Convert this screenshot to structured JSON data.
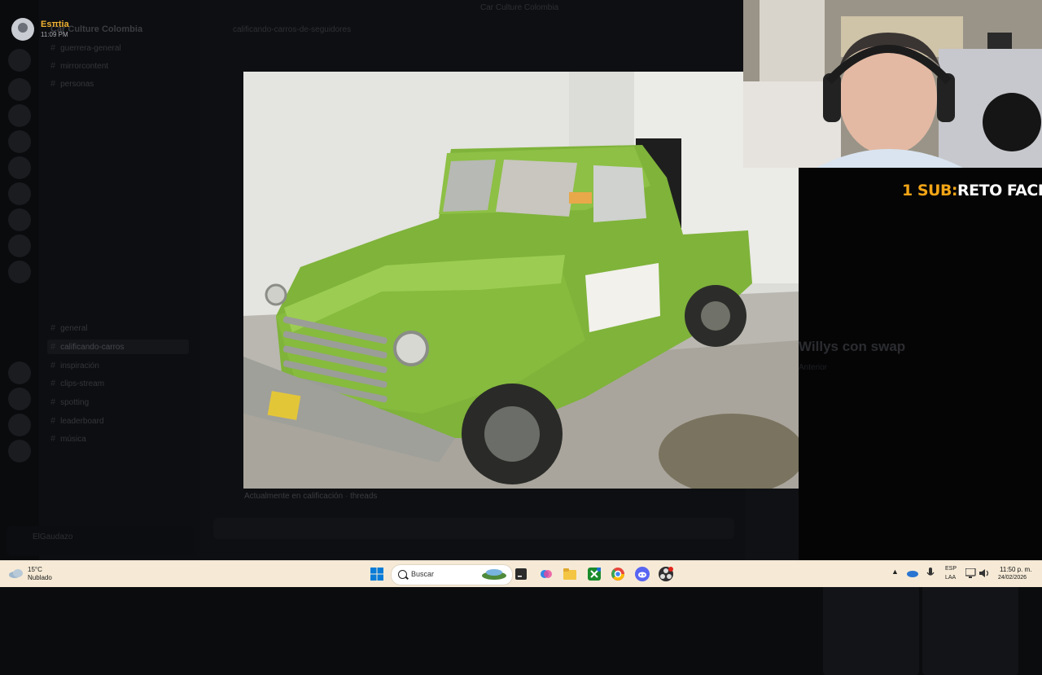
{
  "user": {
    "name": "Esπtia",
    "time": "11:09 PM"
  },
  "server": {
    "name": "Car Culture Colombia"
  },
  "window": {
    "title": "Car Culture Colombia"
  },
  "topbar": {
    "channel": "calificando-carros-de-seguidores"
  },
  "channels": [
    {
      "label": "guerrera-general"
    },
    {
      "label": "mirrorcontent"
    },
    {
      "label": "personas"
    },
    {
      "label": "general"
    },
    {
      "label": "calificando-carros"
    },
    {
      "label": "inspiración"
    },
    {
      "label": "clips-stream"
    },
    {
      "label": "spotting"
    },
    {
      "label": "leaderboard"
    },
    {
      "label": "música"
    }
  ],
  "caption": {
    "text": "Actualmente en calificación",
    "threads": "threads"
  },
  "overlay": {
    "sub_prefix": "1 SUB:",
    "sub_name": "RETO FACIL"
  },
  "post": {
    "title": "Willys con swap",
    "meta": "Anterior"
  },
  "user_panel": {
    "name": "ElGaudazo"
  },
  "taskbar": {
    "weather": {
      "temp": "15°C",
      "condition": "Nublado"
    },
    "search_placeholder": "Buscar",
    "lang_line1": "ESP",
    "lang_line2": "LAA",
    "time": "11:50 p. m.",
    "date": "24/02/2026",
    "icons": [
      "windows-logo",
      "search",
      "widgets",
      "terminal",
      "copilot",
      "file-explorer",
      "xbox",
      "chrome",
      "discord",
      "obs"
    ]
  },
  "colors": {
    "sub_prefix": "#f2a516",
    "username": "#f0b232",
    "taskbar_bg": "#f6ead6"
  }
}
